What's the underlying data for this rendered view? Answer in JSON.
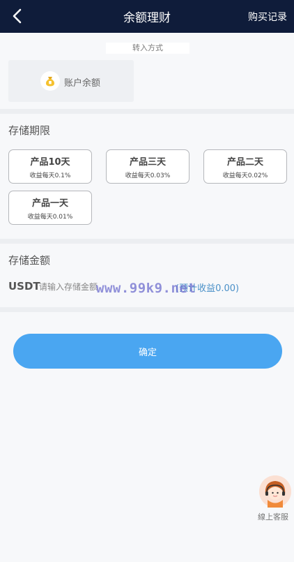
{
  "header": {
    "title": "余额理财",
    "records_link": "购买记录"
  },
  "method": {
    "label": "转入方式",
    "option_label": "账户余额"
  },
  "storage_period": {
    "title": "存储期限",
    "products": [
      {
        "name": "产品10天",
        "rate": "收益每天0.1%"
      },
      {
        "name": "产品三天",
        "rate": "收益每天0.03%"
      },
      {
        "name": "产品二天",
        "rate": "收益每天0.02%"
      },
      {
        "name": "产品一天",
        "rate": "收益每天0.01%"
      }
    ]
  },
  "storage_amount": {
    "title": "存储金额",
    "currency": "USDT",
    "input_value": "",
    "input_placeholder": "请输入存储金额",
    "expected_label": "(预计收益0.00)"
  },
  "watermark": "www.99k9.net",
  "confirm_label": "确定",
  "customer_service": {
    "label": "線上客服"
  },
  "colors": {
    "header_bg": "#0f1c3a",
    "button_bg": "#4aa6f1",
    "expected_text": "#4a90c8"
  },
  "icons": {
    "back": "chevron-left-icon",
    "balance": "money-bag-icon",
    "service": "customer-service-avatar-icon"
  }
}
